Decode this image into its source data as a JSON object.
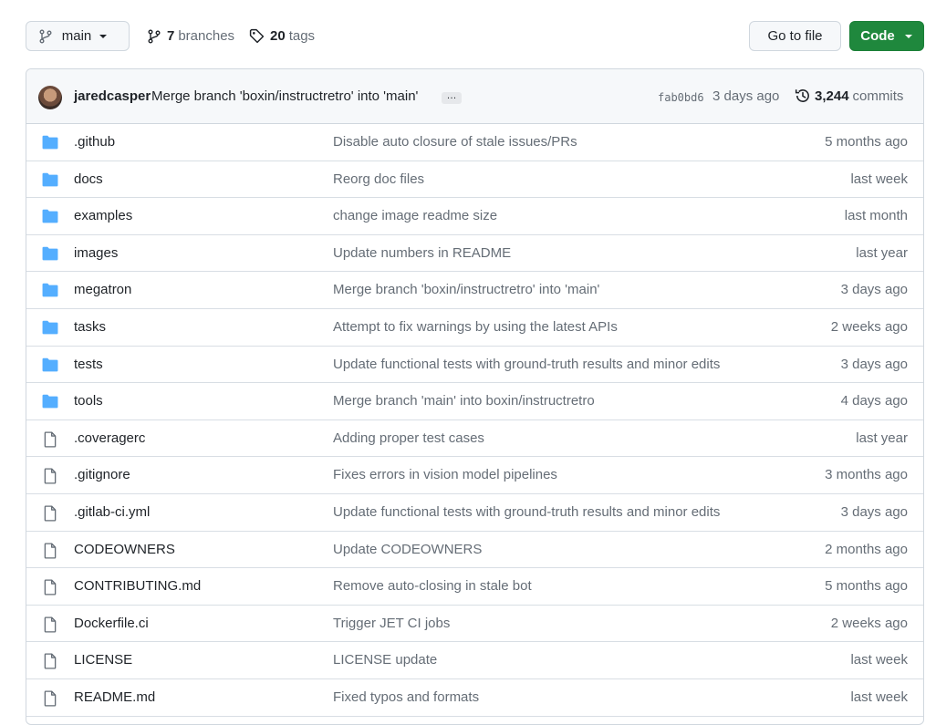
{
  "toolbar": {
    "branch": "main",
    "branches_count": "7",
    "branches_label": "branches",
    "tags_count": "20",
    "tags_label": "tags",
    "goto_file": "Go to file",
    "code": "Code"
  },
  "latest_commit": {
    "author": "jaredcasper",
    "message": "Merge branch 'boxin/instructretro' into 'main'",
    "ellipsis": "…",
    "sha": "fab0bd6",
    "time": "3 days ago",
    "commits_count": "3,244",
    "commits_label": "commits"
  },
  "files": [
    {
      "type": "dir",
      "name": ".github",
      "message": "Disable auto closure of stale issues/PRs",
      "time": "5 months ago"
    },
    {
      "type": "dir",
      "name": "docs",
      "message": "Reorg doc files",
      "time": "last week"
    },
    {
      "type": "dir",
      "name": "examples",
      "message": "change image readme size",
      "time": "last month"
    },
    {
      "type": "dir",
      "name": "images",
      "message": "Update numbers in README",
      "time": "last year"
    },
    {
      "type": "dir",
      "name": "megatron",
      "message": "Merge branch 'boxin/instructretro' into 'main'",
      "time": "3 days ago"
    },
    {
      "type": "dir",
      "name": "tasks",
      "message": "Attempt to fix warnings by using the latest APIs",
      "time": "2 weeks ago"
    },
    {
      "type": "dir",
      "name": "tests",
      "message": "Update functional tests with ground-truth results and minor edits",
      "time": "3 days ago"
    },
    {
      "type": "dir",
      "name": "tools",
      "message": "Merge branch 'main' into boxin/instructretro",
      "time": "4 days ago"
    },
    {
      "type": "file",
      "name": ".coveragerc",
      "message": "Adding proper test cases",
      "time": "last year"
    },
    {
      "type": "file",
      "name": ".gitignore",
      "message": "Fixes errors in vision model pipelines",
      "time": "3 months ago"
    },
    {
      "type": "file",
      "name": ".gitlab-ci.yml",
      "message": "Update functional tests with ground-truth results and minor edits",
      "time": "3 days ago"
    },
    {
      "type": "file",
      "name": "CODEOWNERS",
      "message": "Update CODEOWNERS",
      "time": "2 months ago"
    },
    {
      "type": "file",
      "name": "CONTRIBUTING.md",
      "message": "Remove auto-closing in stale bot",
      "time": "5 months ago"
    },
    {
      "type": "file",
      "name": "Dockerfile.ci",
      "message": "Trigger JET CI jobs",
      "time": "2 weeks ago"
    },
    {
      "type": "file",
      "name": "LICENSE",
      "message": "LICENSE update",
      "time": "last week"
    },
    {
      "type": "file",
      "name": "README.md",
      "message": "Fixed typos and formats",
      "time": "last week"
    }
  ],
  "colors": {
    "folder_icon": "#54aeff",
    "file_icon": "#656d76",
    "code_button": "#1f883d"
  }
}
